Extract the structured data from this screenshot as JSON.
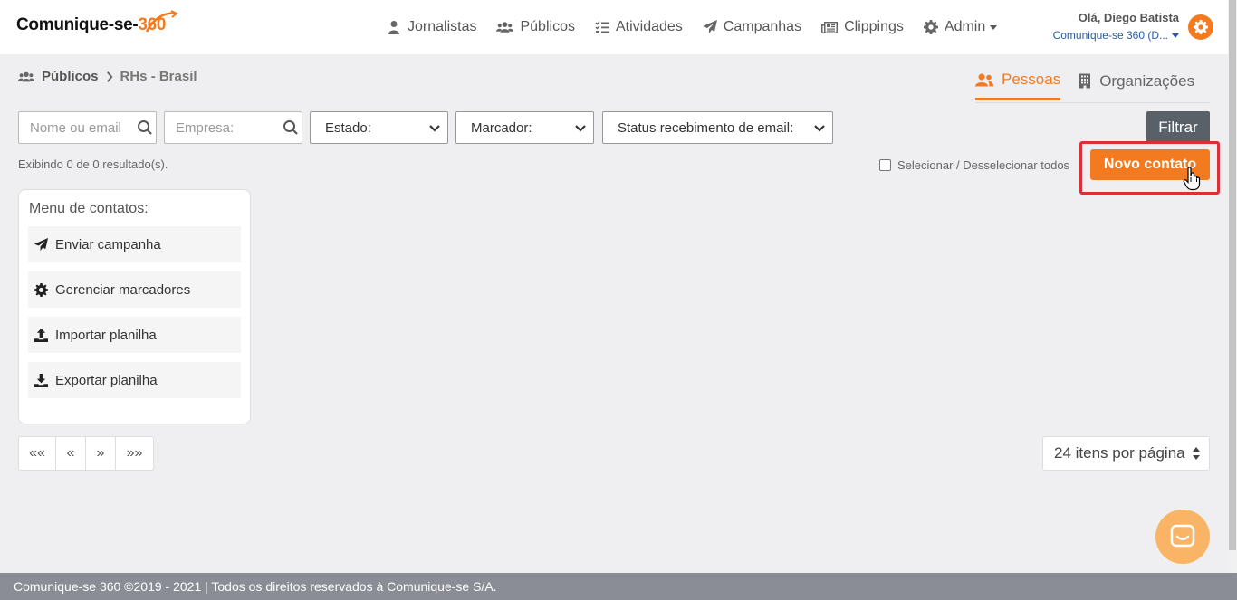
{
  "brand": {
    "name": "Comunique-se",
    "number": "360"
  },
  "nav": {
    "items": [
      {
        "label": "Jornalistas",
        "icon": "user-tie-icon"
      },
      {
        "label": "Públicos",
        "icon": "users-icon"
      },
      {
        "label": "Atividades",
        "icon": "tasks-icon"
      },
      {
        "label": "Campanhas",
        "icon": "paper-plane-icon"
      },
      {
        "label": "Clippings",
        "icon": "newspaper-icon"
      },
      {
        "label": "Admin",
        "icon": "gear-icon"
      }
    ]
  },
  "user": {
    "greeting": "Olá, Diego Batista",
    "company": "Comunique-se 360 (D..."
  },
  "breadcrumb": {
    "parent": "Públicos",
    "current": "RHs - Brasil"
  },
  "tabs": [
    {
      "label": "Pessoas",
      "active": true
    },
    {
      "label": "Organizações",
      "active": false
    }
  ],
  "filters": {
    "name_placeholder": "Nome ou email",
    "company_placeholder": "Empresa:",
    "state": "Estado:",
    "tag": "Marcador:",
    "email_status": "Status recebimento de email:",
    "filter_label": "Filtrar"
  },
  "results_text": "Exibindo 0 de 0 resultado(s).",
  "select_all_label": "Selecionar / Desselecionar todos",
  "new_contact_label": "Novo contato",
  "menu": {
    "title": "Menu de contatos:",
    "items": [
      {
        "label": "Enviar campanha",
        "icon": "paper-plane-icon"
      },
      {
        "label": "Gerenciar marcadores",
        "icon": "gear-icon"
      },
      {
        "label": "Importar planilha",
        "icon": "upload-icon"
      },
      {
        "label": "Exportar planilha",
        "icon": "download-icon"
      }
    ]
  },
  "pagination": {
    "first": "««",
    "prev": "«",
    "next": "»",
    "last": "»»"
  },
  "per_page": "24 itens por página",
  "footer": "Comunique-se 360 ©2019 - 2021 | Todos os direitos reservados à Comunique-se S/A.",
  "colors": {
    "accent": "#f47a20",
    "highlight": "#d9303a",
    "footer": "#8a8d96"
  }
}
